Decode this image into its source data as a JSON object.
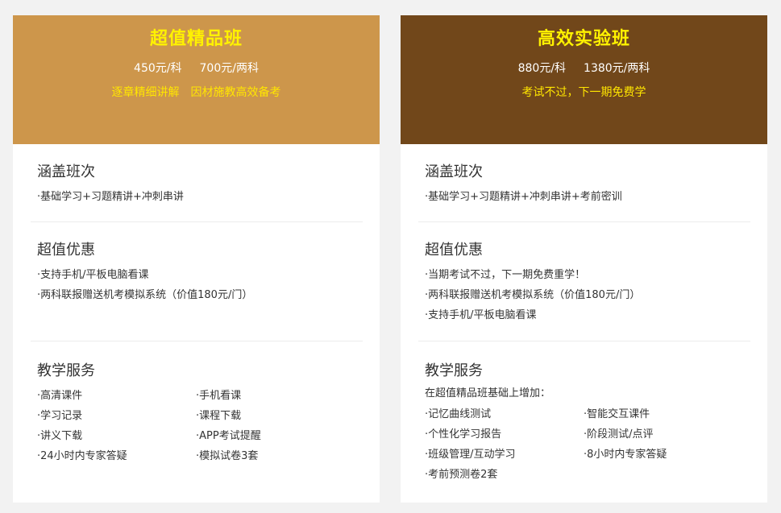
{
  "left_card": {
    "title": "超值精品班",
    "price_single": "450元/科",
    "price_double": "700元/两科",
    "tagline_1": "逐章精细讲解",
    "tagline_2": "因材施教高效备考",
    "coverage": {
      "title": "涵盖班次",
      "items": [
        "·基础学习+习题精讲+冲刺串讲"
      ]
    },
    "benefits": {
      "title": "超值优惠",
      "items": [
        "·支持手机/平板电脑看课",
        "·两科联报赠送机考模拟系统（价值180元/门）"
      ]
    },
    "services": {
      "title": "教学服务",
      "items": [
        "·高清课件",
        "·手机看课",
        "·学习记录",
        "·课程下载",
        "·讲义下载",
        "·APP考试提醒",
        "·24小时内专家答疑",
        "·模拟试卷3套"
      ]
    }
  },
  "right_card": {
    "title": "高效实验班",
    "price_single": "880元/科",
    "price_double": "1380元/两科",
    "tagline": "考试不过，下一期免费学",
    "coverage": {
      "title": "涵盖班次",
      "items": [
        "·基础学习+习题精讲+冲刺串讲+考前密训"
      ]
    },
    "benefits": {
      "title": "超值优惠",
      "items": [
        "·当期考试不过，下一期免费重学！",
        "·两科联报赠送机考模拟系统（价值180元/门）",
        "·支持手机/平板电脑看课"
      ]
    },
    "services": {
      "title": "教学服务",
      "intro": "在超值精品班基础上增加：",
      "items": [
        "·记忆曲线测试",
        "·智能交互课件",
        "·个性化学习报告",
        "·阶段测试/点评",
        "·班级管理/互动学习",
        "·8小时内专家答疑",
        "·考前预测卷2套"
      ]
    }
  },
  "colors": {
    "left_header": "#cd964b",
    "right_header": "#71471a",
    "title_yellow": "#fff200",
    "page_bg": "#f2f2f2"
  }
}
